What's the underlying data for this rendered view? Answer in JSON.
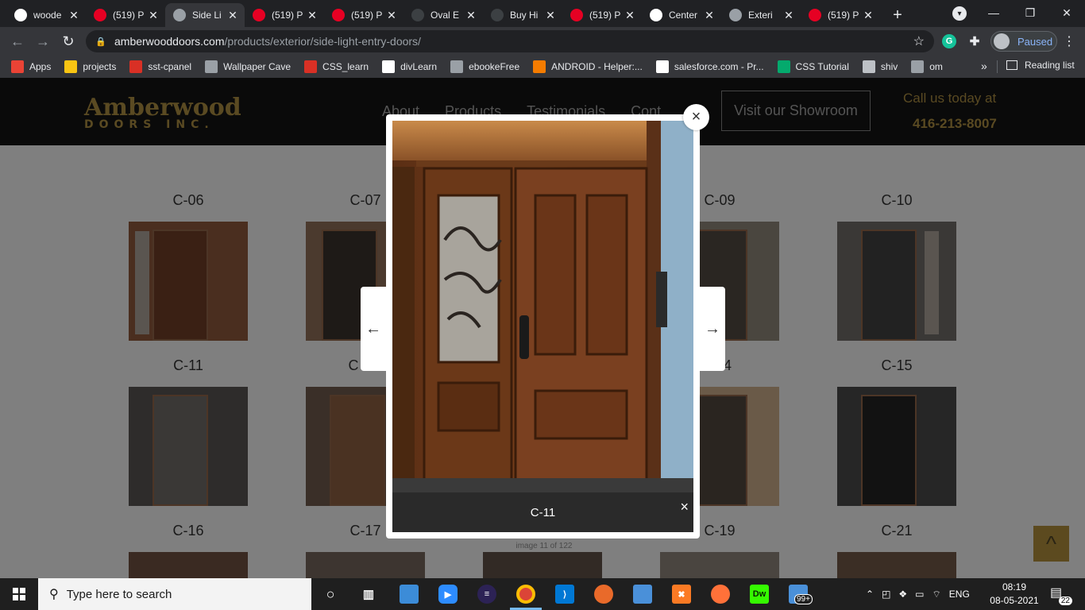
{
  "browser": {
    "tabs": [
      {
        "title": "woode",
        "icon": "google-icon",
        "color": "#ffffff"
      },
      {
        "title": "(519) P",
        "icon": "pinterest-icon",
        "color": "#e60023"
      },
      {
        "title": "Side Li",
        "icon": "globe-icon",
        "color": "#9aa0a6",
        "active": true
      },
      {
        "title": "(519) P",
        "icon": "pinterest-icon",
        "color": "#e60023"
      },
      {
        "title": "(519) P",
        "icon": "pinterest-icon",
        "color": "#e60023"
      },
      {
        "title": "Oval E",
        "icon": "page-icon",
        "color": "#3c4043"
      },
      {
        "title": "Buy Hi",
        "icon": "page-icon",
        "color": "#3c4043"
      },
      {
        "title": "(519) P",
        "icon": "pinterest-icon",
        "color": "#e60023"
      },
      {
        "title": "Center",
        "icon": "amazon-icon",
        "color": "#ffffff"
      },
      {
        "title": "Exteri",
        "icon": "globe-icon",
        "color": "#9aa0a6"
      },
      {
        "title": "(519) P",
        "icon": "pinterest-icon",
        "color": "#e60023"
      }
    ],
    "new_tab": "+",
    "url_host": "amberwooddoors.com",
    "url_path": "/products/exterior/side-light-entry-doors/",
    "profile_status": "Paused",
    "bookmarks": [
      {
        "label": "Apps",
        "icon": "apps-grid-icon",
        "color": "#ea4335"
      },
      {
        "label": "projects",
        "icon": "folder-icon",
        "color": "#f9c513"
      },
      {
        "label": "sst-cpanel",
        "icon": "cpanel-icon",
        "color": "#d93025"
      },
      {
        "label": "Wallpaper Cave",
        "icon": "wallpaper-cave-icon",
        "color": "#9aa0a6"
      },
      {
        "label": "CSS_learn",
        "icon": "css-learn-icon",
        "color": "#d93025"
      },
      {
        "label": "divLearn",
        "icon": "divlearn-icon",
        "color": "#ffffff"
      },
      {
        "label": "ebookeFree",
        "icon": "globe-icon",
        "color": "#9aa0a6"
      },
      {
        "label": "ANDROID - Helper:...",
        "icon": "blogger-icon",
        "color": "#f57c00"
      },
      {
        "label": "salesforce.com - Pr...",
        "icon": "salesforce-icon",
        "color": "#ffffff"
      },
      {
        "label": "CSS Tutorial",
        "icon": "w3schools-icon",
        "color": "#04aa6d"
      },
      {
        "label": "shiv",
        "icon": "shiv-icon",
        "color": "#bdc1c6"
      },
      {
        "label": "om",
        "icon": "globe-icon",
        "color": "#9aa0a6"
      }
    ],
    "more_bookmarks": "»",
    "reading_list": "Reading list"
  },
  "site": {
    "logo_line1": "Amberwood",
    "logo_line2": "DOORS INC.",
    "nav": [
      "About",
      "Products",
      "Testimonials",
      "Cont"
    ],
    "showroom_button": "Visit our Showroom",
    "call_text": "Call us today at",
    "phone": "416-213-8007"
  },
  "gallery": {
    "captions_row1": [
      "C-06",
      "C-07",
      "C-09",
      "C-10"
    ],
    "captions_row2": [
      "C-11",
      "C",
      "4",
      "C-15"
    ],
    "captions_row3": [
      "C-16",
      "C-17",
      "C-19",
      "C-21"
    ]
  },
  "lightbox": {
    "caption": "C-11",
    "counter": "image 11 of 122",
    "close_symbol": "×",
    "prev_symbol": "←",
    "next_symbol": "→"
  },
  "taskbar": {
    "search_placeholder": "Type here to search",
    "language": "ENG",
    "time": "08:19",
    "date": "08-05-2021",
    "notification_count": "22",
    "badge": "99+"
  }
}
